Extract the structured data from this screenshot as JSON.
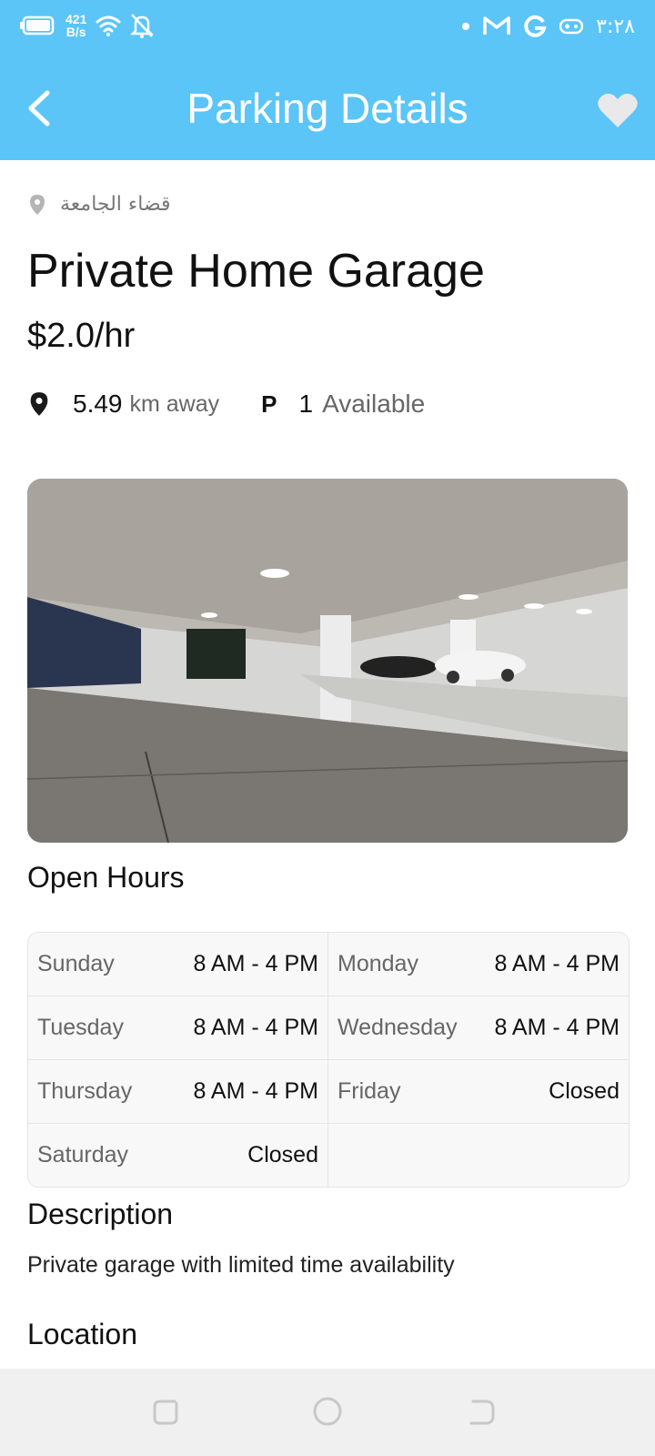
{
  "status_bar": {
    "net_speed_value": "421",
    "net_speed_unit": "B/s",
    "clock": "٣:٢٨",
    "icons": [
      "battery-icon",
      "wifi-icon",
      "bell-off-icon",
      "dot-icon",
      "gmail-icon",
      "google-icon",
      "game-icon"
    ]
  },
  "app_bar": {
    "title": "Parking Details",
    "color": "#5bc5f8"
  },
  "parking": {
    "location_name": "قضاء الجامعة",
    "name": "Private Home Garage",
    "price": "$2.0/hr",
    "distance_value": "5.49",
    "distance_unit": "km away",
    "parking_glyph": "P",
    "available_count": "1",
    "available_label": "Available"
  },
  "open_hours": {
    "title": "Open Hours",
    "rows": [
      [
        {
          "day": "Sunday",
          "time": "8 AM - 4 PM"
        },
        {
          "day": "Monday",
          "time": "8 AM - 4 PM"
        }
      ],
      [
        {
          "day": "Tuesday",
          "time": "8 AM - 4 PM"
        },
        {
          "day": "Wednesday",
          "time": "8 AM - 4 PM"
        }
      ],
      [
        {
          "day": "Thursday",
          "time": "8 AM - 4 PM"
        },
        {
          "day": "Friday",
          "time": "Closed"
        }
      ],
      [
        {
          "day": "Saturday",
          "time": "Closed"
        },
        {
          "day": "",
          "time": ""
        }
      ]
    ]
  },
  "description": {
    "title": "Description",
    "text": "Private garage with limited time availability"
  },
  "location_section": {
    "title": "Location"
  }
}
